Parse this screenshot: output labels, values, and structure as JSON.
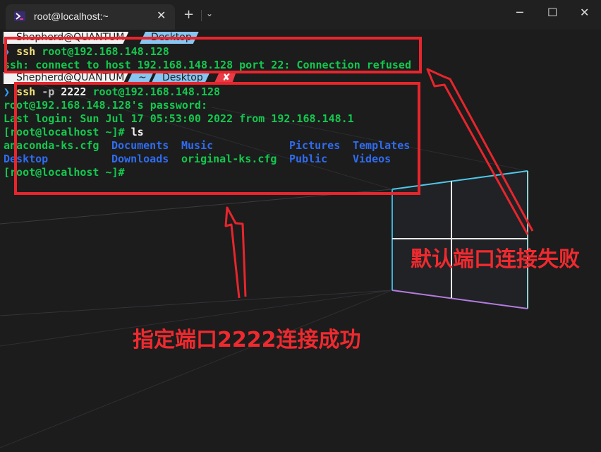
{
  "window": {
    "tab_title": "root@localhost:~",
    "tab_close": "✕",
    "new_tab": "+",
    "dropdown": "⌄",
    "minimize": "─",
    "maximize": "☐",
    "close": "✕"
  },
  "prompt1": {
    "user": "Shepherd@QUANTUM",
    "dir": "Desktop"
  },
  "cmd1": {
    "arrow": "❯",
    "cmd": "ssh",
    "args": "root@192.168.148.128"
  },
  "out1": "ssh: connect to host 192.168.148.128 port 22: Connection refused",
  "prompt2": {
    "user": "Shepherd@QUANTUM",
    "home": "~",
    "dir": "Desktop",
    "err": "✘"
  },
  "cmd2": {
    "arrow": "❯",
    "cmd": "ssh",
    "flag": "-p",
    "port": "2222",
    "args": "root@192.168.148.128"
  },
  "session": {
    "password_line": "root@192.168.148.128's password:",
    "last_login": "Last login: Sun Jul 17 05:53:00 2022 from 192.168.148.1",
    "ls_prompt": "[root@localhost ~]#",
    "ls_cmd": " ls",
    "final_prompt": "[root@localhost ~]#"
  },
  "ls": {
    "row1": [
      "anaconda-ks.cfg",
      "Documents",
      "Music",
      "Pictures",
      "Templates"
    ],
    "row2": [
      "Desktop",
      "Downloads",
      "original-ks.cfg",
      "Public",
      "Videos"
    ]
  },
  "annotations": {
    "failed": "默认端口连接失败",
    "success": "指定端口2222连接成功"
  },
  "colors": {
    "annotation_red": "#e8252c",
    "terminal_green": "#13c84e",
    "directory_blue": "#2f6cf0",
    "terminal_bg": "#1c1c1c"
  }
}
